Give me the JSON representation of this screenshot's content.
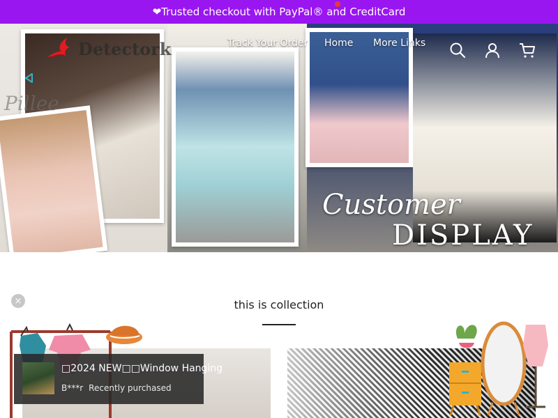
{
  "announcement": {
    "text": "❤Trusted checkout with PayPal® and CreditCard"
  },
  "brand": {
    "name": "Detectork"
  },
  "nav": {
    "links": [
      "Track Your Order",
      "Home",
      "More Links"
    ],
    "icons": [
      "search-icon",
      "account-icon",
      "cart-icon"
    ]
  },
  "hero": {
    "script_text": "Pillee",
    "title_line1": "Customer",
    "title_line2": "DISPLAY"
  },
  "collection": {
    "title": "this is collection"
  },
  "toast": {
    "title": "□2024 NEW□□Window Hanging",
    "buyer": "B***r",
    "status": "Recently purchased"
  },
  "close_label": "×",
  "colors": {
    "announcement_bg": "#9a16f0",
    "logo_accent": "#e01b24",
    "back_arrow": "#2fb3c9"
  }
}
